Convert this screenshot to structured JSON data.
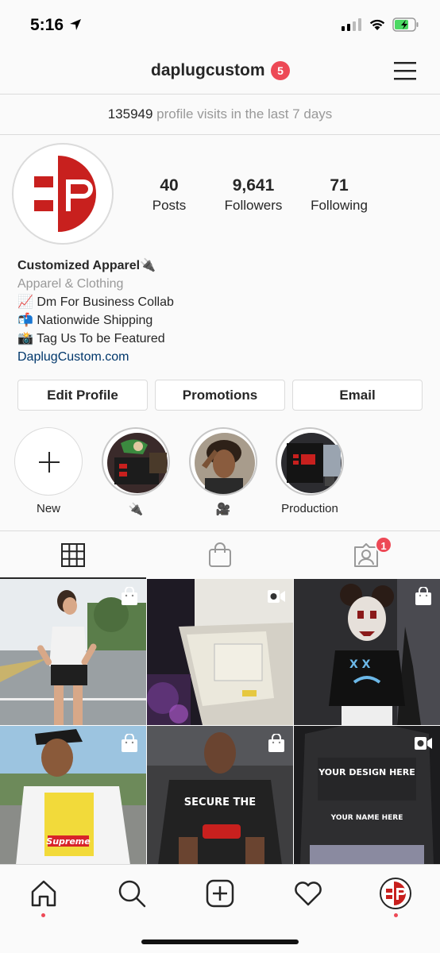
{
  "status_bar": {
    "time": "5:16"
  },
  "header": {
    "username": "daplugcustom",
    "notification_count": "5"
  },
  "visits": {
    "count": "135949",
    "text": "profile visits in the last 7 days"
  },
  "stats": [
    {
      "value": "40",
      "label": "Posts"
    },
    {
      "value": "9,641",
      "label": "Followers"
    },
    {
      "value": "71",
      "label": "Following"
    }
  ],
  "bio": {
    "name": "Customized Apparel🔌",
    "category": "Apparel & Clothing",
    "line1": "📈 Dm For Business Collab",
    "line2": "📬 Nationwide Shipping",
    "line3": "📸 Tag Us To be Featured",
    "link": "DaplugCustom.com"
  },
  "buttons": {
    "edit_profile": "Edit Profile",
    "promotions": "Promotions",
    "email": "Email"
  },
  "highlights": [
    {
      "label": "New"
    },
    {
      "label": "🔌"
    },
    {
      "label": "🎥"
    },
    {
      "label": "Production"
    }
  ],
  "tabs": {
    "tagged_badge": "1"
  },
  "grid_text": {
    "design": "YOUR DESIGN HERE",
    "name": "YOUR NAME HERE",
    "secure": "SECURE THE",
    "supreme": "Supreme"
  },
  "colors": {
    "accent_red": "#ed4956",
    "brand_red": "#c8201e",
    "link": "#00376b"
  }
}
